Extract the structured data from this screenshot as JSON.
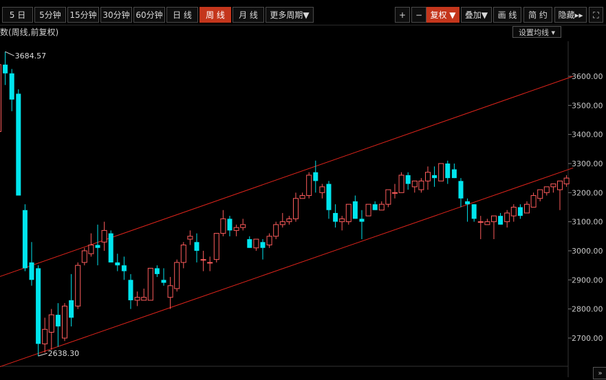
{
  "toolbar": {
    "periods": [
      "5 日",
      "5分钟",
      "15分钟",
      "30分钟",
      "60分钟",
      "日 线",
      "周 线",
      "月 线",
      "更多周期"
    ],
    "active_period": "周 线",
    "plus": "+",
    "minus": "−",
    "adjust": "复权",
    "overlay": "叠加",
    "draw": "画 线",
    "simple": "简 约",
    "hide": "隐藏",
    "fullscreen": "⛶"
  },
  "subtitle": "数(周线,前复权)",
  "ma_settings": "设置均线",
  "collapse": "»",
  "colors": {
    "up": "#ff5c5c",
    "down": "#00e5ee",
    "channel": "#e0241b",
    "bg": "#000000"
  },
  "chart_data": {
    "type": "candlestick",
    "ylim": [
      2600,
      3700
    ],
    "yticks": [
      "3600.00",
      "3500.00",
      "3400.00",
      "3300.00",
      "3200.00",
      "3100.00",
      "3000.00",
      "2900.00",
      "2800.00",
      "2700.00"
    ],
    "max_label": "3684.57",
    "min_label": "2638.30",
    "candles": [
      [
        3410,
        3640,
        3400,
        3640
      ],
      [
        3640,
        3684.57,
        3570,
        3610
      ],
      [
        3610,
        3625,
        3480,
        3520
      ],
      [
        3540,
        3555,
        3190,
        3190
      ],
      [
        3140,
        3160,
        2930,
        2940
      ],
      [
        2960,
        3030,
        2880,
        2900
      ],
      [
        2940,
        2950,
        2638.3,
        2680
      ],
      [
        2680,
        2770,
        2650,
        2730
      ],
      [
        2720,
        2800,
        2660,
        2780
      ],
      [
        2780,
        2820,
        2670,
        2740
      ],
      [
        2700,
        2820,
        2690,
        2810
      ],
      [
        2830,
        2920,
        2740,
        2770
      ],
      [
        2810,
        2960,
        2800,
        2950
      ],
      [
        2960,
        3010,
        2950,
        3000
      ],
      [
        2990,
        3060,
        2980,
        3020
      ],
      [
        3020,
        3090,
        2950,
        3010
      ],
      [
        3030,
        3100,
        3000,
        3070
      ],
      [
        3060,
        3070,
        2960,
        2960
      ],
      [
        2960,
        2990,
        2930,
        2950
      ],
      [
        2950,
        2980,
        2900,
        2930
      ],
      [
        2900,
        2920,
        2800,
        2830
      ],
      [
        2830,
        2860,
        2810,
        2840
      ],
      [
        2830,
        2870,
        2830,
        2840
      ],
      [
        2830,
        2940,
        2830,
        2940
      ],
      [
        2940,
        2950,
        2910,
        2920
      ],
      [
        2900,
        2940,
        2880,
        2890
      ],
      [
        2840,
        2910,
        2800,
        2880
      ],
      [
        2870,
        2970,
        2860,
        2960
      ],
      [
        2960,
        3030,
        2940,
        3020
      ],
      [
        3040,
        3070,
        3020,
        3050
      ],
      [
        3030,
        3060,
        2960,
        3000
      ],
      [
        2970,
        3000,
        2930,
        2970
      ],
      [
        2960,
        2980,
        2930,
        2960
      ],
      [
        2970,
        3060,
        2960,
        3060
      ],
      [
        3060,
        3140,
        3050,
        3110
      ],
      [
        3110,
        3120,
        3050,
        3070
      ],
      [
        3070,
        3090,
        3050,
        3080
      ],
      [
        3080,
        3110,
        3070,
        3090
      ],
      [
        3040,
        3050,
        3010,
        3010
      ],
      [
        3010,
        3040,
        3000,
        3040
      ],
      [
        3030,
        3040,
        2970,
        3010
      ],
      [
        3020,
        3060,
        3010,
        3050
      ],
      [
        3050,
        3100,
        3040,
        3090
      ],
      [
        3090,
        3130,
        3080,
        3100
      ],
      [
        3100,
        3120,
        3090,
        3110
      ],
      [
        3110,
        3200,
        3100,
        3180
      ],
      [
        3180,
        3200,
        3180,
        3190
      ],
      [
        3190,
        3270,
        3180,
        3260
      ],
      [
        3270,
        3310,
        3200,
        3240
      ],
      [
        3200,
        3230,
        3180,
        3220
      ],
      [
        3230,
        3240,
        3110,
        3140
      ],
      [
        3130,
        3160,
        3080,
        3100
      ],
      [
        3100,
        3120,
        3070,
        3110
      ],
      [
        3100,
        3140,
        3090,
        3160
      ],
      [
        3170,
        3190,
        3110,
        3110
      ],
      [
        3110,
        3140,
        3040,
        3100
      ],
      [
        3120,
        3160,
        3120,
        3160
      ],
      [
        3160,
        3170,
        3140,
        3140
      ],
      [
        3140,
        3170,
        3140,
        3160
      ],
      [
        3160,
        3210,
        3150,
        3210
      ],
      [
        3200,
        3230,
        3180,
        3200
      ],
      [
        3200,
        3270,
        3200,
        3260
      ],
      [
        3260,
        3270,
        3210,
        3230
      ],
      [
        3220,
        3240,
        3200,
        3240
      ],
      [
        3210,
        3250,
        3200,
        3240
      ],
      [
        3240,
        3290,
        3210,
        3270
      ],
      [
        3260,
        3290,
        3220,
        3250
      ],
      [
        3240,
        3300,
        3240,
        3300
      ],
      [
        3300,
        3310,
        3230,
        3250
      ],
      [
        3280,
        3300,
        3250,
        3250
      ],
      [
        3240,
        3250,
        3150,
        3180
      ],
      [
        3170,
        3180,
        3100,
        3160
      ],
      [
        3160,
        3160,
        3100,
        3110
      ],
      [
        3100,
        3120,
        3040,
        3100
      ],
      [
        3090,
        3110,
        3090,
        3100
      ],
      [
        3100,
        3120,
        3040,
        3120
      ],
      [
        3120,
        3130,
        3090,
        3090
      ],
      [
        3100,
        3140,
        3080,
        3130
      ],
      [
        3120,
        3160,
        3100,
        3150
      ],
      [
        3150,
        3160,
        3110,
        3120
      ],
      [
        3130,
        3170,
        3130,
        3160
      ],
      [
        3150,
        3200,
        3150,
        3190
      ],
      [
        3180,
        3210,
        3170,
        3210
      ],
      [
        3200,
        3220,
        3190,
        3220
      ],
      [
        3220,
        3230,
        3200,
        3230
      ],
      [
        3210,
        3240,
        3140,
        3240
      ],
      [
        3230,
        3260,
        3220,
        3250
      ]
    ],
    "channel_upper": [
      [
        0,
        2910
      ],
      [
        87,
        3600
      ]
    ],
    "channel_lower": [
      [
        0,
        2600
      ],
      [
        87,
        3285
      ]
    ]
  }
}
